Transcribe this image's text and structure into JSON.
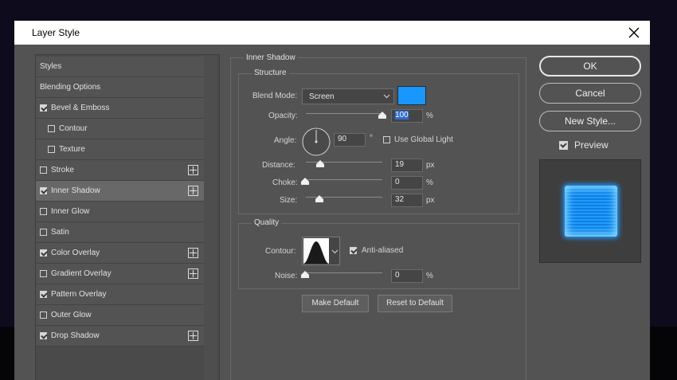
{
  "dialog": {
    "title": "Layer Style"
  },
  "styles_list": {
    "items": [
      {
        "label": "Styles",
        "checkbox": false,
        "checked": false,
        "plus": false
      },
      {
        "label": "Blending Options",
        "checkbox": false,
        "checked": false,
        "plus": false
      },
      {
        "label": "Bevel & Emboss",
        "checkbox": true,
        "checked": true,
        "plus": false
      },
      {
        "label": "Contour",
        "checkbox": true,
        "checked": false,
        "plus": false,
        "indent": true
      },
      {
        "label": "Texture",
        "checkbox": true,
        "checked": false,
        "plus": false,
        "indent": true
      },
      {
        "label": "Stroke",
        "checkbox": true,
        "checked": false,
        "plus": true
      },
      {
        "label": "Inner Shadow",
        "checkbox": true,
        "checked": true,
        "plus": true,
        "selected": true
      },
      {
        "label": "Inner Glow",
        "checkbox": true,
        "checked": false,
        "plus": false
      },
      {
        "label": "Satin",
        "checkbox": true,
        "checked": false,
        "plus": false
      },
      {
        "label": "Color Overlay",
        "checkbox": true,
        "checked": true,
        "plus": true
      },
      {
        "label": "Gradient Overlay",
        "checkbox": true,
        "checked": false,
        "plus": true
      },
      {
        "label": "Pattern Overlay",
        "checkbox": true,
        "checked": true,
        "plus": false
      },
      {
        "label": "Outer Glow",
        "checkbox": true,
        "checked": false,
        "plus": false
      },
      {
        "label": "Drop Shadow",
        "checkbox": true,
        "checked": true,
        "plus": true
      }
    ]
  },
  "inner_shadow": {
    "section_title": "Inner Shadow",
    "structure": {
      "title": "Structure",
      "blend_mode_label": "Blend Mode:",
      "blend_mode_value": "Screen",
      "shadow_color": "#1a96ff",
      "opacity_label": "Opacity:",
      "opacity_value": "100",
      "opacity_unit": "%",
      "angle_label": "Angle:",
      "angle_value": "90",
      "angle_unit": "°",
      "use_global_light_label": "Use Global Light",
      "use_global_light_checked": false,
      "distance_label": "Distance:",
      "distance_value": "19",
      "distance_unit": "px",
      "choke_label": "Choke:",
      "choke_value": "0",
      "choke_unit": "%",
      "size_label": "Size:",
      "size_value": "32",
      "size_unit": "px"
    },
    "quality": {
      "title": "Quality",
      "contour_label": "Contour:",
      "anti_aliased_label": "Anti-aliased",
      "anti_aliased_checked": true,
      "noise_label": "Noise:",
      "noise_value": "0",
      "noise_unit": "%"
    },
    "make_default_label": "Make Default",
    "reset_default_label": "Reset to Default"
  },
  "actions": {
    "ok_label": "OK",
    "cancel_label": "Cancel",
    "new_style_label": "New Style...",
    "preview_label": "Preview",
    "preview_checked": true
  },
  "colors": {
    "dialog_bg": "#535353",
    "accent_blue": "#1a96ff"
  }
}
